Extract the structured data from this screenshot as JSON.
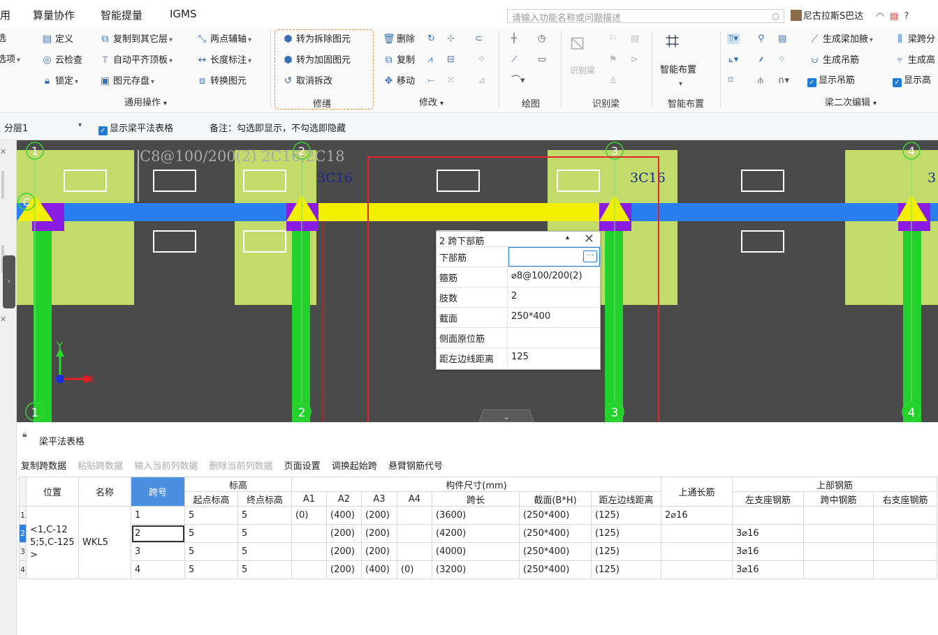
{
  "menu": {
    "items": [
      "用",
      "算量协作",
      "智能提量",
      "IGMS"
    ],
    "search_placeholder": "请输入功能名称或问题描述",
    "user": "尼古拉斯S巴达"
  },
  "ribbon": {
    "general": {
      "edge1": "选",
      "edge2": "选项",
      "define": "定义",
      "cloud_check": "云检查",
      "lock": "锁定",
      "copy_to_floor": "复制到其它层",
      "auto_flush_top": "自动平齐顶板",
      "element_save": "图元存盘",
      "two_point_axis": "两点辅轴",
      "length_dim": "长度标注",
      "convert_element": "转换图元",
      "label": "通用操作"
    },
    "repair": {
      "to_demolish": "转为拆除图元",
      "to_reinforce": "转为加固图元",
      "cancel_demolish": "取消拆改",
      "label": "修缮"
    },
    "modify": {
      "delete": "删除",
      "copy": "复制",
      "move": "移动",
      "label": "修改"
    },
    "draw": {
      "label": "绘图"
    },
    "identify": {
      "identify_beam": "识别梁",
      "label": "识别梁"
    },
    "smart": {
      "smart_layout": "智能布置",
      "label": "智能布置"
    },
    "beam_edit": {
      "gen_haunch": "生成梁加腋",
      "gen_hanger": "生成吊筋",
      "show_hanger": "显示吊筋",
      "beam_span": "梁跨分",
      "gen_high": "生成高",
      "show_high": "显示高",
      "label": "梁二次编辑"
    }
  },
  "toolbar2": {
    "layer": "分层1",
    "show_table": "显示梁平法表格",
    "note": "备注：勾选即显示，不勾选即隐藏"
  },
  "canvas": {
    "axis_top": [
      "1",
      "2",
      "3",
      "4"
    ],
    "axis_bottom": [
      "1",
      "2",
      "3",
      "4"
    ],
    "axis_c": "C",
    "beam_text": "C8@100/200(2) 2C16;2C18",
    "bar_label_1": "3C16",
    "bar_label_2": "3C16",
    "bar_label_3": "3",
    "axis_x": "X",
    "axis_y": "Y"
  },
  "popup": {
    "title": "2 跨下部筋",
    "rows": [
      {
        "key": "下部筋",
        "value": ""
      },
      {
        "key": "箍筋",
        "value": "⌀8@100/200(2)"
      },
      {
        "key": "肢数",
        "value": "2"
      },
      {
        "key": "截面",
        "value": "250*400"
      },
      {
        "key": "侧面原位筋",
        "value": ""
      },
      {
        "key": "距左边线距离",
        "value": "125"
      }
    ]
  },
  "panel": {
    "title": "梁平法表格",
    "buttons": [
      "复制跨数据",
      "粘贴跨数据",
      "输入当前列数据",
      "删除当前列数据",
      "页面设置",
      "调换起始跨",
      "悬臂钢筋代号"
    ],
    "disabled": [
      false,
      true,
      true,
      true,
      false,
      false,
      false
    ]
  },
  "table": {
    "groups": {
      "position": "位置",
      "name": "名称",
      "span": "跨号",
      "elevation": "标高",
      "dims": "构件尺寸(mm)",
      "top_through": "上通长筋",
      "top_bars": "上部钢筋"
    },
    "sub": [
      "起点标高",
      "终点标高",
      "A1",
      "A2",
      "A3",
      "A4",
      "跨长",
      "截面(B*H)",
      "距左边线距离",
      "左支座钢筋",
      "跨中钢筋",
      "右支座钢筋"
    ],
    "position_value": "<1,C-125;5,C-125>",
    "name_value": "WKL5",
    "row_numbers": [
      "1",
      "2",
      "3",
      "4"
    ],
    "rows": [
      [
        "1",
        "5",
        "5",
        "(0)",
        "(400)",
        "(200)",
        "",
        "(3600)",
        "(250*400)",
        "(125)",
        "2⌀16",
        "",
        "",
        ""
      ],
      [
        "2",
        "5",
        "5",
        "",
        "(200)",
        "(200)",
        "",
        "(4200)",
        "(250*400)",
        "(125)",
        "",
        "3⌀16",
        "",
        ""
      ],
      [
        "3",
        "5",
        "5",
        "",
        "(200)",
        "(200)",
        "",
        "(4000)",
        "(250*400)",
        "(125)",
        "",
        "3⌀16",
        "",
        ""
      ],
      [
        "4",
        "5",
        "5",
        "",
        "(200)",
        "(400)",
        "(0)",
        "(3200)",
        "(250*400)",
        "(125)",
        "",
        "3⌀16",
        "",
        ""
      ]
    ]
  }
}
